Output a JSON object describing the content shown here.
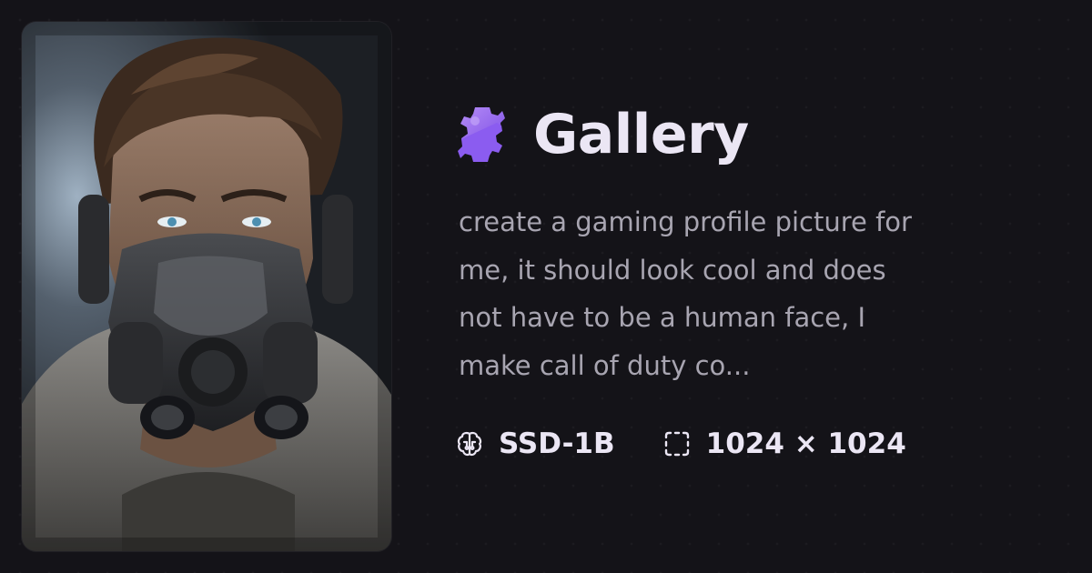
{
  "header": {
    "logo_icon": "bolt-gear-logo-icon",
    "title": "Gallery",
    "accent_color": "#9c6bf2"
  },
  "image": {
    "subject_icon": "gas-mask-portrait"
  },
  "prompt": {
    "lines": [
      "create a gaming profile picture for",
      "me, it should look cool and does",
      "not have to be a human face, I",
      "make call of duty co..."
    ]
  },
  "meta": {
    "model": {
      "icon": "brain-icon",
      "label": "SSD-1B"
    },
    "size": {
      "icon": "dashed-square-icon",
      "label": "1024 × 1024"
    }
  }
}
